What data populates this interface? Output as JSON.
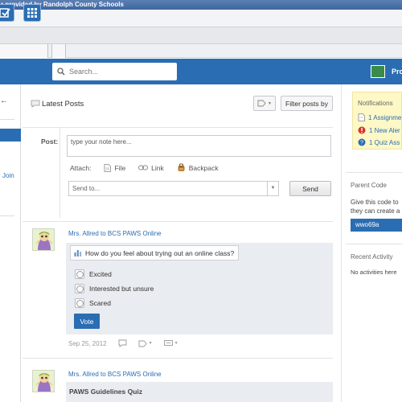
{
  "browser": {
    "title_fragment": "r provided by Randolph County Schools"
  },
  "header": {
    "search_placeholder": "Search...",
    "profile_label": "Pro"
  },
  "sidebar": {
    "join_label": "Join"
  },
  "feed": {
    "title": "Latest Posts",
    "filter_label": "Filter posts by",
    "composer": {
      "post_label": "Post:",
      "note_placeholder": "type your note here...",
      "attach_label": "Attach:",
      "file_label": "File",
      "link_label": "Link",
      "backpack_label": "Backpack",
      "sendto_placeholder": "Send to...",
      "send_label": "Send"
    },
    "posts": [
      {
        "author": "Mrs. Allred to BCS PAWS Online",
        "poll_question": "How do you feel about trying out an online class?",
        "options": [
          "Excited",
          "Interested but unsure",
          "Scared"
        ],
        "vote_label": "Vote",
        "date": "Sep 25, 2012"
      },
      {
        "author": "Mrs. Allred to BCS PAWS Online",
        "title": "PAWS Guidelines Quiz"
      }
    ]
  },
  "notifications": {
    "title": "Notifications",
    "items": [
      {
        "text": "1 Assignme",
        "icon": "pencil-note-icon",
        "color": "#2a6db3"
      },
      {
        "text": "1 New Aler",
        "icon": "alert-icon",
        "color": "#d9342b"
      },
      {
        "text": "1 Quiz Ass",
        "icon": "quiz-icon",
        "color": "#2a6db3"
      }
    ]
  },
  "parent_code": {
    "title": "Parent Code",
    "desc_line1": "Give this code to",
    "desc_line2": "they can create a",
    "code": "wwo69a"
  },
  "recent_activity": {
    "title": "Recent Activity",
    "empty_text": "No activities here"
  },
  "colors": {
    "brand_blue": "#2a6db3",
    "notification_bg": "#fdf8c6",
    "poll_bg": "#e9ecf0"
  }
}
